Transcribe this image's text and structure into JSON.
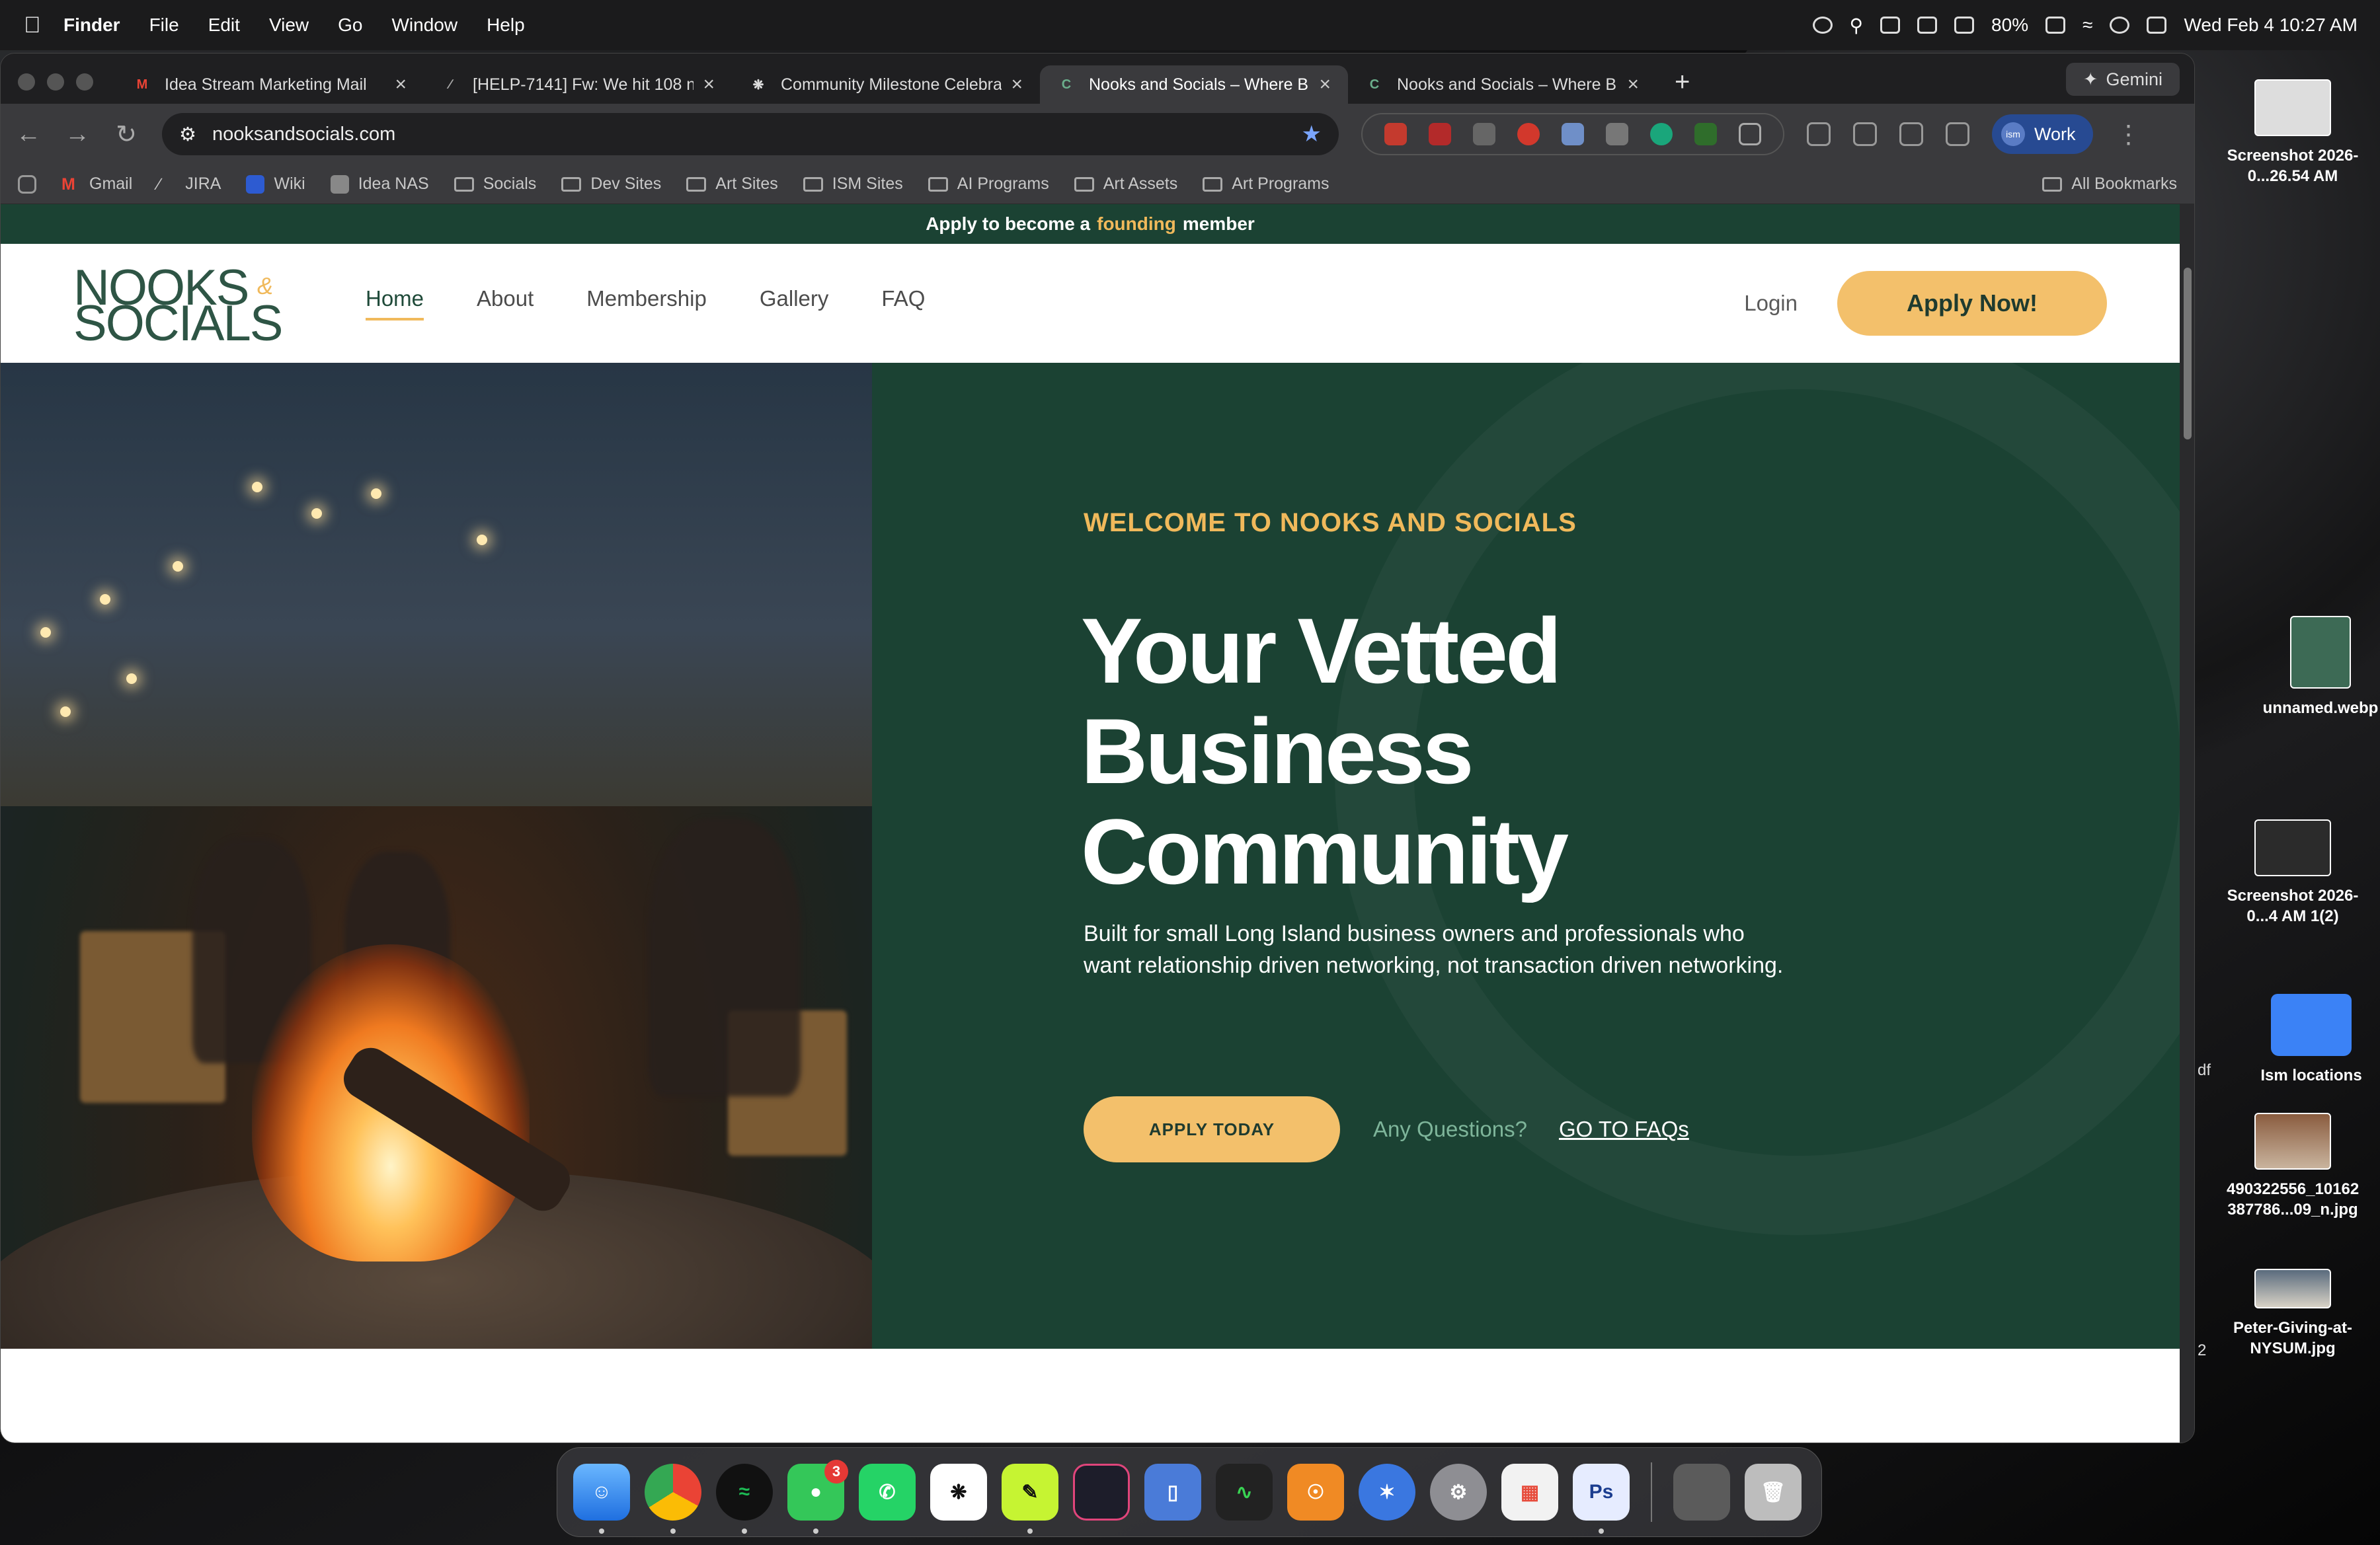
{
  "menubar": {
    "app": "Finder",
    "items": [
      "File",
      "Edit",
      "View",
      "Go",
      "Window",
      "Help"
    ],
    "battery": "80%",
    "datetime": "Wed Feb 4  10:27 AM"
  },
  "browser": {
    "tabs": [
      {
        "title": "Idea Stream Marketing Mail",
        "favicon": "gmail-icon"
      },
      {
        "title": "[HELP-7141] Fw: We hit 108 n",
        "favicon": "jira-icon"
      },
      {
        "title": "Community Milestone Celebra",
        "favicon": "openai-icon"
      },
      {
        "title": "Nooks and Socials – Where B",
        "favicon": "nooks-icon",
        "active": true
      },
      {
        "title": "Nooks and Socials – Where B",
        "favicon": "nooks-icon"
      }
    ],
    "gemini_label": "Gemini",
    "url": "nooksandsocials.com",
    "profile_label": "Work",
    "profile_initials": "ism",
    "bookmarks": [
      "Gmail",
      "JIRA",
      "Wiki",
      "Idea NAS",
      "Socials",
      "Dev Sites",
      "Art Sites",
      "ISM Sites",
      "AI Programs",
      "Art Assets",
      "Art Programs"
    ],
    "all_bookmarks": "All Bookmarks"
  },
  "site": {
    "announcement": {
      "pre": "Apply to become a",
      "highlight": "founding",
      "post": "member"
    },
    "logo": {
      "line1": "NOOKS",
      "line2": "SOCIALS",
      "amp": "&"
    },
    "nav": [
      {
        "label": "Home",
        "active": true
      },
      {
        "label": "About"
      },
      {
        "label": "Membership"
      },
      {
        "label": "Gallery"
      },
      {
        "label": "FAQ"
      }
    ],
    "login": "Login",
    "apply_now": "Apply Now!",
    "hero": {
      "eyebrow": "WELCOME TO NOOKS AND SOCIALS",
      "headline": "Your Vetted Business Community",
      "description": "Built for small Long Island business owners and professionals who want relationship driven networking, not transaction driven networking.",
      "apply_today": "APPLY TODAY",
      "questions": "Any Questions?",
      "faq_link": "GO TO FAQs"
    }
  },
  "desktop": {
    "icons": [
      {
        "label": "Screenshot 2026-0...26.54 AM"
      },
      {
        "label": "unnamed.webp"
      },
      {
        "label": "Screenshot 2026-0...4 AM 1(2)"
      },
      {
        "label": "Ism locations"
      },
      {
        "label": "490322556_10162 387786...09_n.jpg"
      },
      {
        "label": "Peter-Giving-at-NYSUM.jpg"
      }
    ],
    "side_fragments": [
      "df",
      "2"
    ]
  },
  "dock": {
    "apps": [
      "Finder",
      "Chrome",
      "Spotify",
      "Messages",
      "WhatsApp",
      "ChatGPT",
      "Scrivener",
      "Screens",
      "iPhone Mirroring",
      "Activity Monitor",
      "Podcast",
      "Elpass",
      "System Settings",
      "Launchpad",
      "Photoshop",
      "Images",
      "Trash"
    ],
    "messages_badge": "3"
  }
}
